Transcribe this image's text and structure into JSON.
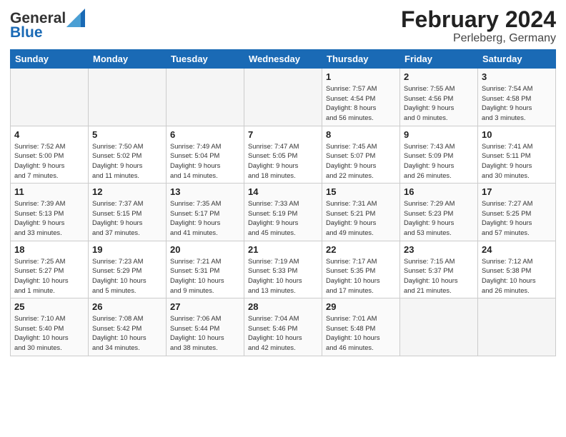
{
  "header": {
    "logo_general": "General",
    "logo_blue": "Blue",
    "month_title": "February 2024",
    "location": "Perleberg, Germany"
  },
  "days_of_week": [
    "Sunday",
    "Monday",
    "Tuesday",
    "Wednesday",
    "Thursday",
    "Friday",
    "Saturday"
  ],
  "weeks": [
    [
      {
        "day": "",
        "info": ""
      },
      {
        "day": "",
        "info": ""
      },
      {
        "day": "",
        "info": ""
      },
      {
        "day": "",
        "info": ""
      },
      {
        "day": "1",
        "info": "Sunrise: 7:57 AM\nSunset: 4:54 PM\nDaylight: 8 hours\nand 56 minutes."
      },
      {
        "day": "2",
        "info": "Sunrise: 7:55 AM\nSunset: 4:56 PM\nDaylight: 9 hours\nand 0 minutes."
      },
      {
        "day": "3",
        "info": "Sunrise: 7:54 AM\nSunset: 4:58 PM\nDaylight: 9 hours\nand 3 minutes."
      }
    ],
    [
      {
        "day": "4",
        "info": "Sunrise: 7:52 AM\nSunset: 5:00 PM\nDaylight: 9 hours\nand 7 minutes."
      },
      {
        "day": "5",
        "info": "Sunrise: 7:50 AM\nSunset: 5:02 PM\nDaylight: 9 hours\nand 11 minutes."
      },
      {
        "day": "6",
        "info": "Sunrise: 7:49 AM\nSunset: 5:04 PM\nDaylight: 9 hours\nand 14 minutes."
      },
      {
        "day": "7",
        "info": "Sunrise: 7:47 AM\nSunset: 5:05 PM\nDaylight: 9 hours\nand 18 minutes."
      },
      {
        "day": "8",
        "info": "Sunrise: 7:45 AM\nSunset: 5:07 PM\nDaylight: 9 hours\nand 22 minutes."
      },
      {
        "day": "9",
        "info": "Sunrise: 7:43 AM\nSunset: 5:09 PM\nDaylight: 9 hours\nand 26 minutes."
      },
      {
        "day": "10",
        "info": "Sunrise: 7:41 AM\nSunset: 5:11 PM\nDaylight: 9 hours\nand 30 minutes."
      }
    ],
    [
      {
        "day": "11",
        "info": "Sunrise: 7:39 AM\nSunset: 5:13 PM\nDaylight: 9 hours\nand 33 minutes."
      },
      {
        "day": "12",
        "info": "Sunrise: 7:37 AM\nSunset: 5:15 PM\nDaylight: 9 hours\nand 37 minutes."
      },
      {
        "day": "13",
        "info": "Sunrise: 7:35 AM\nSunset: 5:17 PM\nDaylight: 9 hours\nand 41 minutes."
      },
      {
        "day": "14",
        "info": "Sunrise: 7:33 AM\nSunset: 5:19 PM\nDaylight: 9 hours\nand 45 minutes."
      },
      {
        "day": "15",
        "info": "Sunrise: 7:31 AM\nSunset: 5:21 PM\nDaylight: 9 hours\nand 49 minutes."
      },
      {
        "day": "16",
        "info": "Sunrise: 7:29 AM\nSunset: 5:23 PM\nDaylight: 9 hours\nand 53 minutes."
      },
      {
        "day": "17",
        "info": "Sunrise: 7:27 AM\nSunset: 5:25 PM\nDaylight: 9 hours\nand 57 minutes."
      }
    ],
    [
      {
        "day": "18",
        "info": "Sunrise: 7:25 AM\nSunset: 5:27 PM\nDaylight: 10 hours\nand 1 minute."
      },
      {
        "day": "19",
        "info": "Sunrise: 7:23 AM\nSunset: 5:29 PM\nDaylight: 10 hours\nand 5 minutes."
      },
      {
        "day": "20",
        "info": "Sunrise: 7:21 AM\nSunset: 5:31 PM\nDaylight: 10 hours\nand 9 minutes."
      },
      {
        "day": "21",
        "info": "Sunrise: 7:19 AM\nSunset: 5:33 PM\nDaylight: 10 hours\nand 13 minutes."
      },
      {
        "day": "22",
        "info": "Sunrise: 7:17 AM\nSunset: 5:35 PM\nDaylight: 10 hours\nand 17 minutes."
      },
      {
        "day": "23",
        "info": "Sunrise: 7:15 AM\nSunset: 5:37 PM\nDaylight: 10 hours\nand 21 minutes."
      },
      {
        "day": "24",
        "info": "Sunrise: 7:12 AM\nSunset: 5:38 PM\nDaylight: 10 hours\nand 26 minutes."
      }
    ],
    [
      {
        "day": "25",
        "info": "Sunrise: 7:10 AM\nSunset: 5:40 PM\nDaylight: 10 hours\nand 30 minutes."
      },
      {
        "day": "26",
        "info": "Sunrise: 7:08 AM\nSunset: 5:42 PM\nDaylight: 10 hours\nand 34 minutes."
      },
      {
        "day": "27",
        "info": "Sunrise: 7:06 AM\nSunset: 5:44 PM\nDaylight: 10 hours\nand 38 minutes."
      },
      {
        "day": "28",
        "info": "Sunrise: 7:04 AM\nSunset: 5:46 PM\nDaylight: 10 hours\nand 42 minutes."
      },
      {
        "day": "29",
        "info": "Sunrise: 7:01 AM\nSunset: 5:48 PM\nDaylight: 10 hours\nand 46 minutes."
      },
      {
        "day": "",
        "info": ""
      },
      {
        "day": "",
        "info": ""
      }
    ]
  ]
}
